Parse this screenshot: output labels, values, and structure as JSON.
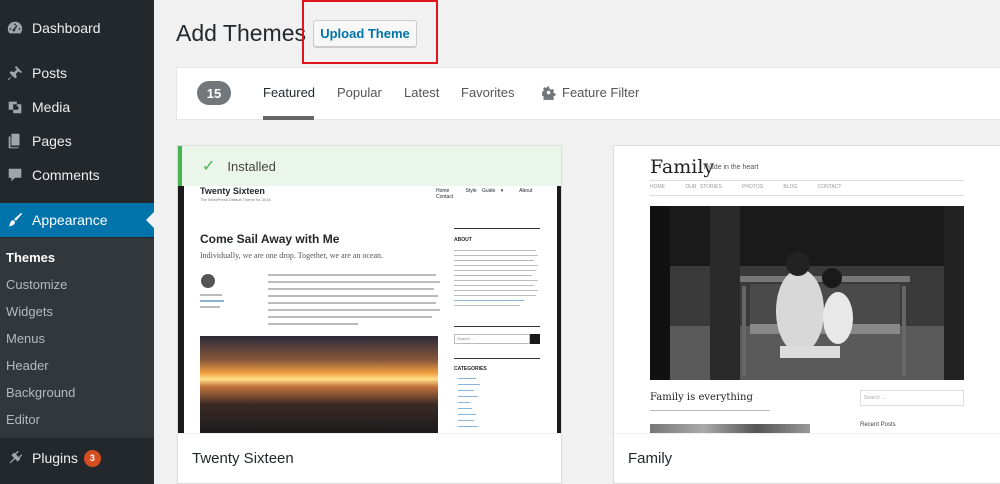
{
  "sidebar": {
    "items": [
      {
        "label": "Dashboard",
        "icon": "dashboard-icon"
      },
      {
        "label": "Posts",
        "icon": "pin-icon"
      },
      {
        "label": "Media",
        "icon": "media-icon"
      },
      {
        "label": "Pages",
        "icon": "pages-icon"
      },
      {
        "label": "Comments",
        "icon": "comment-icon"
      },
      {
        "label": "Appearance",
        "icon": "brush-icon"
      },
      {
        "label": "Plugins",
        "icon": "plugin-icon",
        "badge": "3"
      }
    ],
    "submenu": [
      "Themes",
      "Customize",
      "Widgets",
      "Menus",
      "Header",
      "Background",
      "Editor"
    ]
  },
  "header": {
    "title": "Add Themes",
    "upload_label": "Upload Theme"
  },
  "filter": {
    "count": "15",
    "tabs": [
      "Featured",
      "Popular",
      "Latest",
      "Favorites"
    ],
    "feature_filter": "Feature Filter"
  },
  "themes": [
    {
      "name": "Twenty Sixteen",
      "installed_label": "Installed",
      "preview": {
        "site_title": "Twenty Sixteen",
        "tagline": "The WordPress Default Theme for 2016",
        "nav": [
          "Home",
          "Style Guide ▾",
          "About",
          "Contact"
        ],
        "post_title": "Come Sail Away with Me",
        "post_excerpt": "Individually, we are one drop. Together, we are an ocean.",
        "sidebar_about": "ABOUT",
        "sidebar_search": "Search ...",
        "sidebar_categories": "CATEGORIES"
      }
    },
    {
      "name": "Family",
      "preview": {
        "site_title": "Family",
        "tagline": "made in the heart",
        "nav": [
          "HOME",
          "OUR STORIES",
          "PHOTOS",
          "BLOG",
          "CONTACT"
        ],
        "post_title": "Family is everything",
        "search_placeholder": "Search ...",
        "recent_posts": "Recent Posts"
      }
    }
  ],
  "colors": {
    "sidebar_bg": "#23282d",
    "accent": "#0073aa",
    "installed_green": "#46b450",
    "badge": "#d54e21"
  }
}
